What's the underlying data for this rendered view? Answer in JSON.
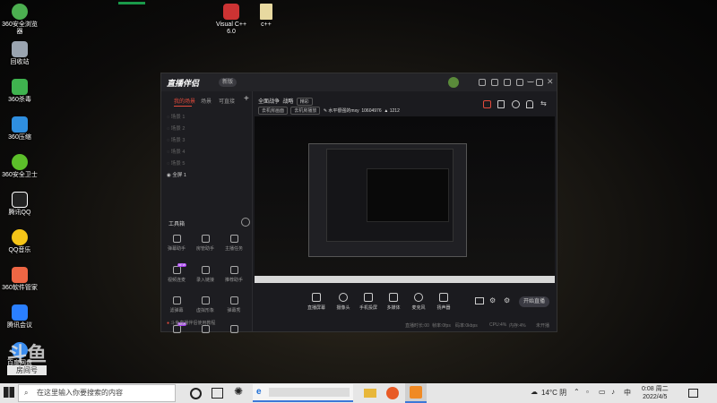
{
  "desktop": {
    "icons": [
      {
        "label": "360安全浏览器",
        "icon": "browser-360-icon",
        "color": "#4caf50"
      },
      {
        "label": "回收站",
        "icon": "recycle-bin-icon",
        "color": "#9aa4b0"
      },
      {
        "label": "360杀毒",
        "icon": "antivirus-360-icon",
        "color": "#3fb34f"
      },
      {
        "label": "360压缩",
        "icon": "compress-360-icon",
        "color": "#2f8fe0"
      },
      {
        "label": "360安全卫士",
        "icon": "security-360-icon",
        "color": "#5cbf2a"
      },
      {
        "label": "腾讯QQ",
        "icon": "qq-icon",
        "color": "#222"
      },
      {
        "label": "QQ音乐",
        "icon": "qq-music-icon",
        "color": "#f5c518"
      },
      {
        "label": "360软件管家",
        "icon": "software-manager-icon",
        "color": "#e64"
      },
      {
        "label": "腾讯会议",
        "icon": "tencent-meeting-icon",
        "color": "#2a7fff"
      },
      {
        "label": "百度网盘",
        "icon": "baidu-disk-icon",
        "color": "#3b8df0"
      },
      {
        "label": "Visual C++ 6.0",
        "icon": "visual-cpp-icon",
        "color": "#c33"
      },
      {
        "label": "c++",
        "icon": "file-icon",
        "color": "#e8d9a0"
      }
    ],
    "watermark": {
      "text": "斗鱼",
      "sub": "房间号"
    }
  },
  "app": {
    "title": "直播伴侣",
    "version_badge": "新版",
    "left_tabs": [
      "我的场景",
      "场景",
      "可直接"
    ],
    "scenes": [
      "场景 1",
      "场景 2",
      "场景 3",
      "场景 4",
      "场景 5",
      "全屏 1"
    ],
    "tools_title": "工具箱",
    "tools": [
      {
        "label": "弹幕助手",
        "icon": "barrage-icon"
      },
      {
        "label": "房管助手",
        "icon": "admin-icon"
      },
      {
        "label": "主播任务",
        "icon": "task-icon"
      },
      {
        "label": "视频连麦",
        "icon": "video-link-icon",
        "new": "NEW"
      },
      {
        "label": "录入链接",
        "icon": "download-icon"
      },
      {
        "label": "推荐助手",
        "icon": "recommend-icon"
      },
      {
        "label": "滤弹幕",
        "icon": "filter-icon"
      },
      {
        "label": "虚拟形象",
        "icon": "avatar-tool-icon"
      },
      {
        "label": "弹幕秀",
        "icon": "danmu-show-icon"
      },
      {
        "label": "",
        "icon": "gift-icon",
        "new": "NEW"
      },
      {
        "label": "",
        "icon": "more-tool-icon"
      },
      {
        "label": "",
        "icon": "upload-icon"
      }
    ],
    "tip": "斗鱼直播伴侣使用教程",
    "room": {
      "category": "全面战争",
      "tag1": "战略",
      "tag2": "精彩",
      "pills": [
        "去机房画面",
        "去机房播放"
      ],
      "user": "水平很强的mxy",
      "uid": "10604976",
      "viewers": "1212"
    },
    "bottom_tools": [
      {
        "label": "直播屏幕",
        "icon": "screen-icon"
      },
      {
        "label": "摄像头",
        "icon": "camera-icon"
      },
      {
        "label": "手机投屏",
        "icon": "phone-cast-icon"
      },
      {
        "label": "多媒体",
        "icon": "media-icon"
      },
      {
        "label": "麦克风",
        "icon": "mic-icon"
      },
      {
        "label": "扬声器",
        "icon": "speaker-icon"
      }
    ],
    "start_button": "开始直播",
    "stats": [
      "直播时长:00",
      "帧率:0fps",
      "码率:0kbps",
      "CPU:4%",
      "内存:4%",
      "未开播"
    ]
  },
  "taskbar": {
    "search_placeholder": "在这里输入你要搜索的内容",
    "weather": "14°C 阴",
    "time": "0:08 周二",
    "date": "2022/4/5",
    "ime": "中"
  }
}
